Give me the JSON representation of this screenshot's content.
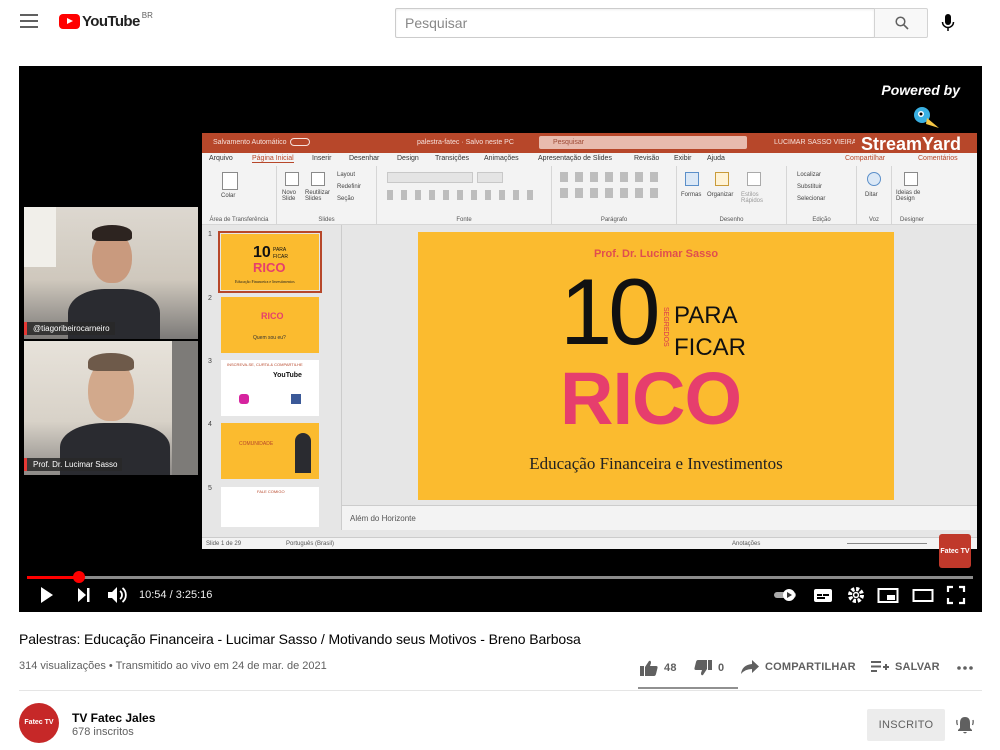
{
  "header": {
    "logo_text": "YouTube",
    "country_code": "BR",
    "search_placeholder": "Pesquisar"
  },
  "player": {
    "powered_by": "Powered by",
    "streamyard": "StreamYard",
    "cameras": [
      {
        "label": "@tiagoribeirocarneiro"
      },
      {
        "label": "Prof. Dr. Lucimar Sasso"
      }
    ],
    "ppt": {
      "autosave": "Salvamento Automático",
      "file": "palestra-fatec · Salvo neste PC",
      "search": "Pesquisar",
      "user": "LUCIMAR SASSO VIEIRA",
      "tabs": [
        "Arquivo",
        "Página Inicial",
        "Inserir",
        "Desenhar",
        "Design",
        "Transições",
        "Animações",
        "Apresentação de Slides",
        "Revisão",
        "Exibir",
        "Ajuda"
      ],
      "share": "Compartilhar",
      "comments": "Comentários",
      "groups": [
        "Área de Transferência",
        "Slides",
        "Fonte",
        "Parágrafo",
        "Desenho",
        "Edição",
        "Voz",
        "Designer"
      ],
      "ribbon_items": {
        "paste": "Colar",
        "new_slide": "Novo Slide",
        "reuse": "Reutilizar Slides",
        "layout": "Layout",
        "reset": "Redefinir",
        "section": "Seção",
        "shapes": "Formas",
        "arrange": "Organizar",
        "quick_styles": "Estilos Rápidos",
        "find": "Localizar",
        "replace": "Substituir",
        "select": "Selecionar",
        "dictate": "Ditar",
        "design_ideas": "Ideias de Design"
      },
      "slide_numbers": [
        "1",
        "2",
        "3",
        "4",
        "5"
      ],
      "thumb1": {
        "num": "10",
        "para": "PARA",
        "ficar": "FICAR",
        "rico": "RICO",
        "sub": "Educação Financeira e Investimentos"
      },
      "thumb2": {
        "rico": "RICO",
        "caption": "Quem sou eu?"
      },
      "thumb3": {
        "caption": "INSCREVA-SE, CURTA & COMPARTILHE",
        "youtube": "YouTube"
      },
      "thumb4": {
        "caption": "COMUNIDADE"
      },
      "thumb5": {
        "caption": "FALE COMIGO"
      },
      "slide": {
        "author": "Prof. Dr. Lucimar Sasso",
        "number": "10",
        "vertical": "SEGREDOS",
        "para": "PARA",
        "ficar": "FICAR",
        "rico": "RICO",
        "subtitle": "Educação Financeira e Investimentos"
      },
      "notes": "Além do Horizonte",
      "status_slide": "Slide 1 de 29",
      "status_lang": "Português (Brasil)",
      "status_notes": "Anotações"
    },
    "badge": "Fatec TV",
    "time_current": "10:54",
    "time_total": "3:25:16",
    "progress_fraction": 0.055
  },
  "video": {
    "title": "Palestras: Educação Financeira - Lucimar Sasso / Motivando seus Motivos - Breno Barbosa",
    "views": "314 visualizações",
    "streamed": "Transmitido ao vivo em 24 de mar. de 2021",
    "likes": "48",
    "dislikes": "0",
    "share_label": "COMPARTILHAR",
    "save_label": "SALVAR"
  },
  "channel": {
    "name": "TV Fatec Jales",
    "subscribers": "678 inscritos",
    "avatar_text": "Fatec TV",
    "subscribe_label": "INSCRITO"
  },
  "colors": {
    "accent": "#ff0000",
    "ppt_brand": "#b7472a",
    "slide_bg": "#fbbb2f",
    "rico": "#e63e6d"
  }
}
